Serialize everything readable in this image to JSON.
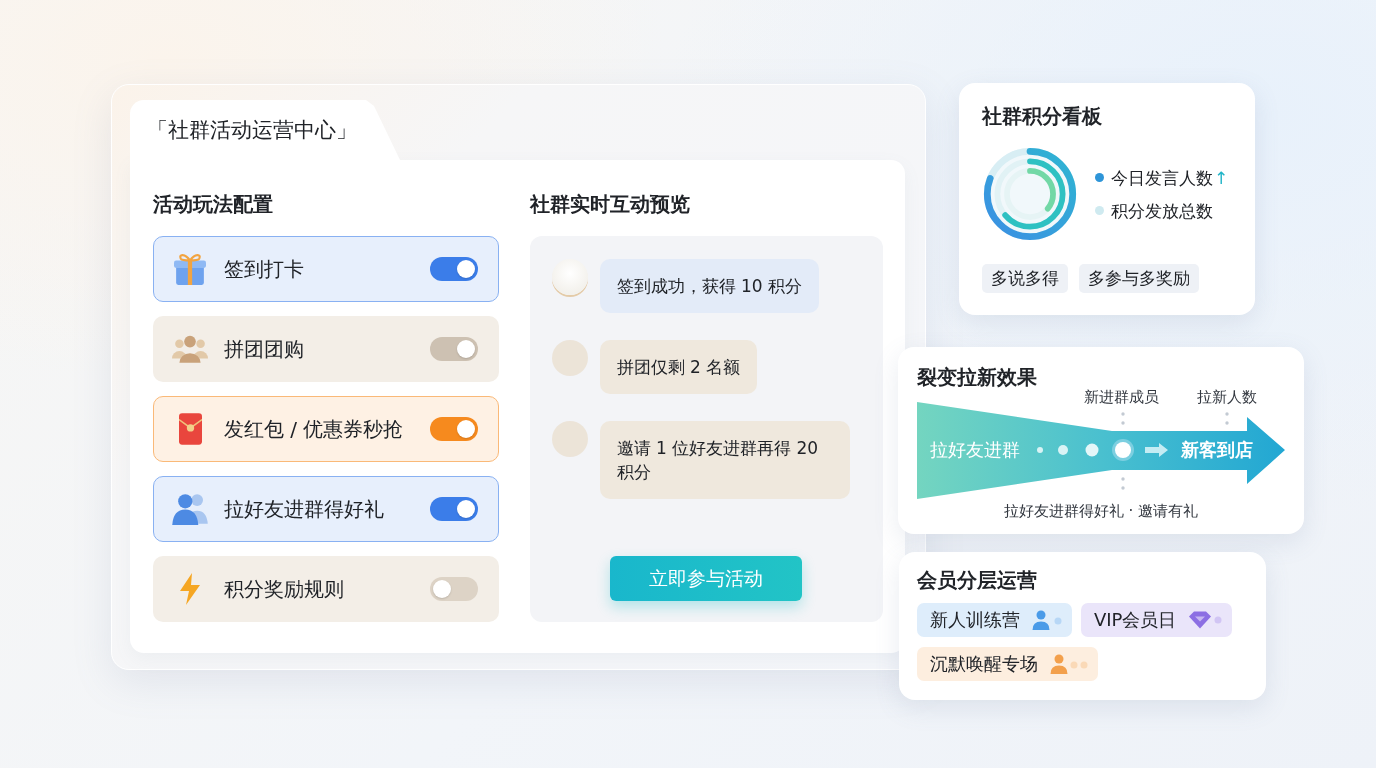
{
  "frame": {
    "tab_title": "「社群活动运营中心」"
  },
  "config": {
    "heading": "活动玩法配置",
    "items": [
      {
        "label": "签到打卡",
        "kind": "gift",
        "on": true,
        "disabled": false,
        "color": "#3b7de9"
      },
      {
        "label": "拼团团购",
        "kind": "group",
        "on": true,
        "disabled": true
      },
      {
        "label": "发红包 / 优惠券秒抢",
        "kind": "envelope",
        "on": true,
        "disabled": false,
        "color": "#f68a1e"
      },
      {
        "label": "拉好友进群得好礼",
        "kind": "friends",
        "on": true,
        "disabled": false,
        "color": "#3b7de9"
      },
      {
        "label": "积分奖励规则",
        "kind": "bolt",
        "on": false,
        "disabled": false
      }
    ]
  },
  "preview": {
    "heading": "社群实时互动预览",
    "messages": [
      {
        "text": "签到成功，获得 10 积分",
        "highlighted": true
      },
      {
        "text": "拼团仅剩 2 名额",
        "highlighted": false
      },
      {
        "text": "邀请 1 位好友进群再得 20 积分",
        "highlighted": false
      }
    ],
    "action_button": "立即参与活动"
  },
  "points_board": {
    "title": "社群积分看板",
    "legend": [
      {
        "label": "今日发言人数",
        "color": "#2e95d8",
        "trend": "↑"
      },
      {
        "label": "积分发放总数",
        "color": "#cfeaf0"
      }
    ],
    "tags": [
      "多说多得",
      "多参与多奖励"
    ]
  },
  "referral": {
    "title": "裂变拉新效果",
    "top_labels": [
      "新进群成员",
      "拉新人数"
    ],
    "start_label": "拉好友进群",
    "end_label": "新客到店",
    "caption": "拉好友进群得好礼 · 邀请有礼"
  },
  "membership": {
    "title": "会员分层运营",
    "segments": [
      {
        "label": "新人训练营",
        "kind": "person",
        "color": "#4a9be8"
      },
      {
        "label": "VIP会员日",
        "kind": "diamond",
        "color": "#8c6fe3"
      },
      {
        "label": "沉默唤醒专场",
        "kind": "people",
        "color": "#f3a04c"
      }
    ]
  }
}
